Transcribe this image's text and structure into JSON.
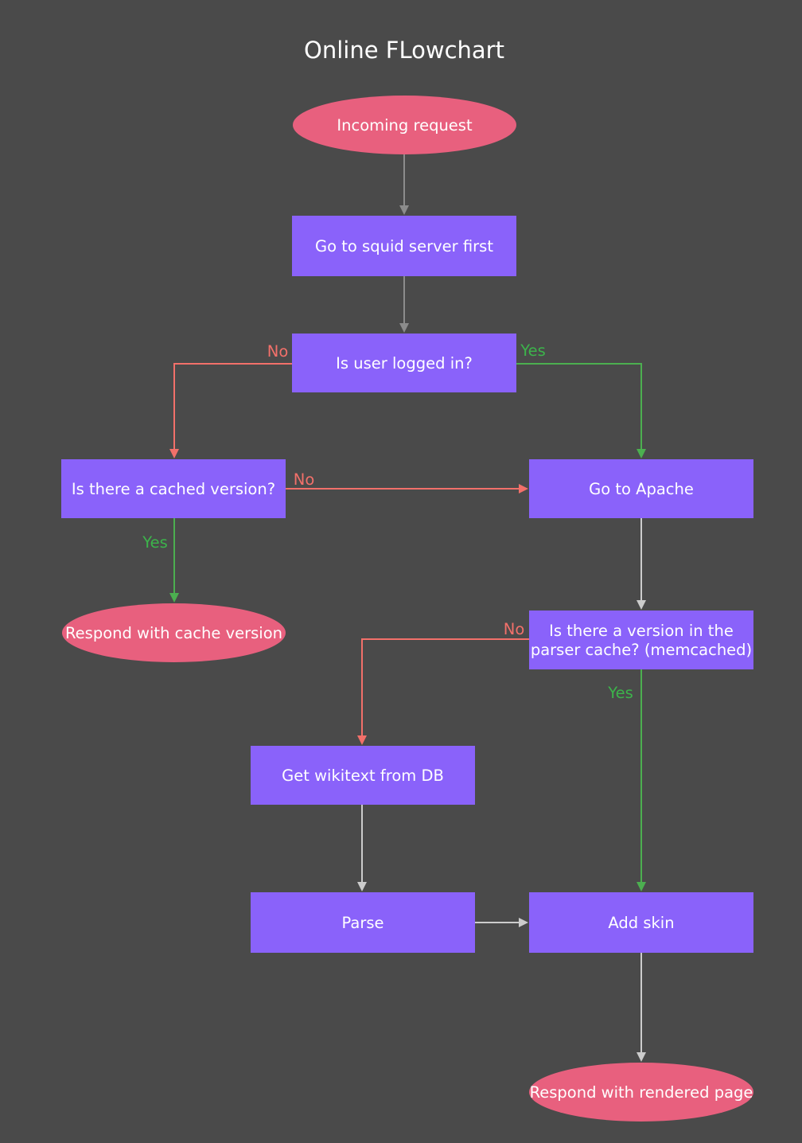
{
  "title": "Online FLowchart",
  "colors": {
    "background": "#4a4a4a",
    "terminal": "#e8607e",
    "process": "#8a62fa",
    "text": "#ffffff",
    "edge_default_dark": "#8c8c8c",
    "edge_default": "#cccccc",
    "edge_no": "#f2706a",
    "edge_yes": "#4caf50",
    "label_no": "#f2706a",
    "label_yes": "#3cb44b"
  },
  "nodes": [
    {
      "id": "incoming",
      "shape": "ellipse",
      "lines": [
        "Incoming request"
      ]
    },
    {
      "id": "squid",
      "shape": "rect",
      "lines": [
        "Go to squid server first"
      ]
    },
    {
      "id": "logged",
      "shape": "rect",
      "lines": [
        "Is user logged in?"
      ]
    },
    {
      "id": "cached",
      "shape": "rect",
      "lines": [
        "Is there a cached version?"
      ]
    },
    {
      "id": "apache",
      "shape": "rect",
      "lines": [
        "Go to Apache"
      ]
    },
    {
      "id": "respond_cache",
      "shape": "ellipse",
      "lines": [
        "Respond with cache version"
      ]
    },
    {
      "id": "parser_cache",
      "shape": "rect",
      "lines": [
        "Is there a version in the",
        "parser cache? (memcached)"
      ]
    },
    {
      "id": "wikitext",
      "shape": "rect",
      "lines": [
        "Get wikitext from DB"
      ]
    },
    {
      "id": "parse",
      "shape": "rect",
      "lines": [
        "Parse"
      ]
    },
    {
      "id": "skin",
      "shape": "rect",
      "lines": [
        "Add skin"
      ]
    },
    {
      "id": "respond_rendered",
      "shape": "ellipse",
      "lines": [
        "Respond with rendered page"
      ]
    }
  ],
  "edges": [
    {
      "from": "incoming",
      "to": "squid",
      "kind": "dark",
      "label": ""
    },
    {
      "from": "squid",
      "to": "logged",
      "kind": "dark",
      "label": ""
    },
    {
      "from": "logged",
      "to": "cached",
      "kind": "no",
      "label": "No"
    },
    {
      "from": "logged",
      "to": "apache",
      "kind": "yes",
      "label": "Yes"
    },
    {
      "from": "cached",
      "to": "apache",
      "kind": "no",
      "label": "No"
    },
    {
      "from": "cached",
      "to": "respond_cache",
      "kind": "yes",
      "label": "Yes"
    },
    {
      "from": "apache",
      "to": "parser_cache",
      "kind": "default",
      "label": ""
    },
    {
      "from": "parser_cache",
      "to": "wikitext",
      "kind": "no",
      "label": "No"
    },
    {
      "from": "parser_cache",
      "to": "skin",
      "kind": "yes",
      "label": "Yes"
    },
    {
      "from": "wikitext",
      "to": "parse",
      "kind": "default",
      "label": ""
    },
    {
      "from": "parse",
      "to": "skin",
      "kind": "default",
      "label": ""
    },
    {
      "from": "skin",
      "to": "respond_rendered",
      "kind": "default",
      "label": ""
    }
  ]
}
